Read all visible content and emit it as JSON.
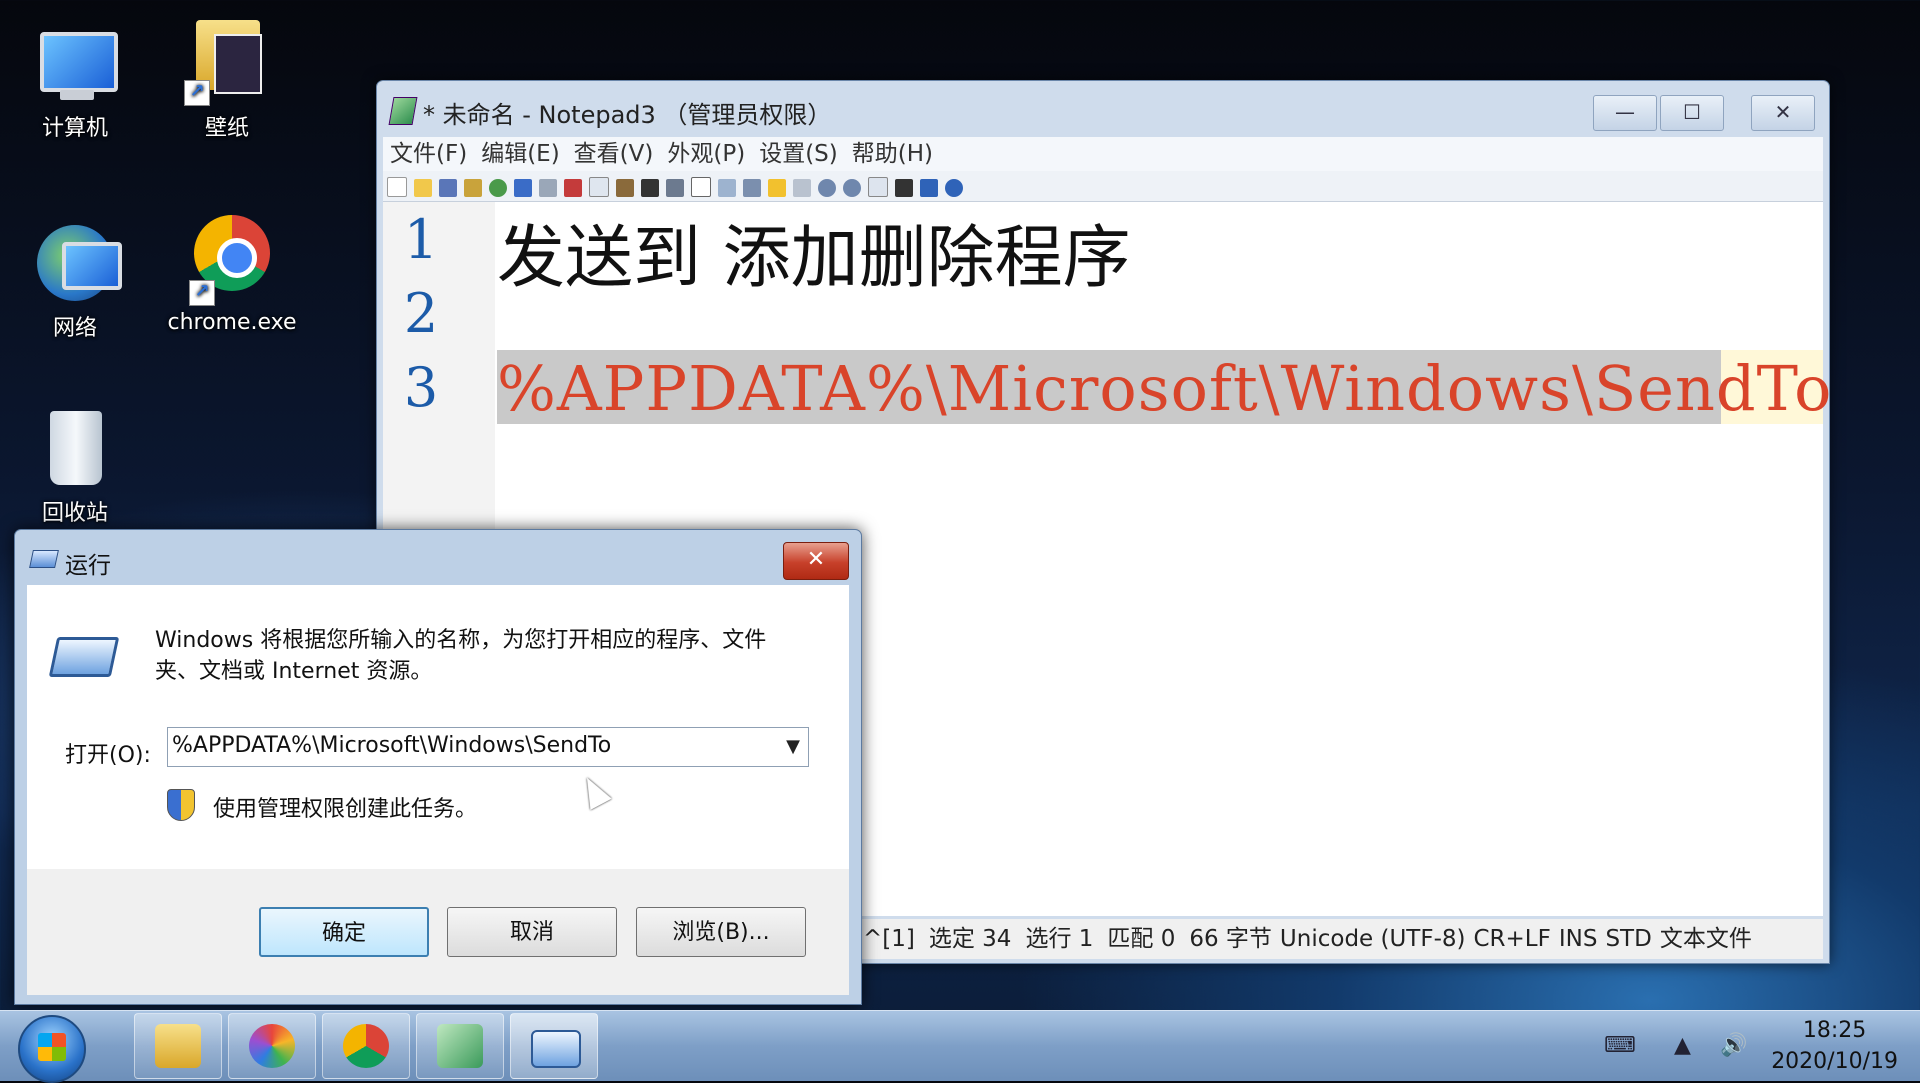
{
  "desktop": {
    "icons": [
      {
        "label": "计算机"
      },
      {
        "label": "壁纸"
      },
      {
        "label": "网络"
      },
      {
        "label": "chrome.exe"
      },
      {
        "label": "回收站"
      }
    ]
  },
  "notepad": {
    "title": "* 未命名 - Notepad3 （管理员权限）",
    "window_buttons": {
      "minimize": "—",
      "maximize": "☐",
      "close": "✕"
    },
    "menu": [
      "文件(F)",
      "编辑(E)",
      "查看(V)",
      "外观(P)",
      "设置(S)",
      "帮助(H)"
    ],
    "lines": [
      {
        "no": "1",
        "text": "发送到 添加删除程序"
      },
      {
        "no": "2",
        "text": ""
      },
      {
        "no": "3",
        "text": "%APPDATA%\\Microsoft\\Windows\\SendTo"
      }
    ],
    "status": [
      "^[1]",
      "选定  34",
      "选行  1",
      "匹配  0",
      "66 字节",
      "Unicode (UTF-8)",
      "CR+LF",
      "INS",
      "STD",
      "文本文件"
    ]
  },
  "run_dialog": {
    "title": "运行",
    "close": "✕",
    "description": "Windows 将根据您所输入的名称，为您打开相应的程序、文件夹、文档或 Internet 资源。",
    "open_label": "打开(O):",
    "open_value": "%APPDATA%\\Microsoft\\Windows\\SendTo",
    "dropdown_glyph": "▼",
    "admin_note": "使用管理权限创建此任务。",
    "buttons": {
      "ok": "确定",
      "cancel": "取消",
      "browse": "浏览(B)..."
    }
  },
  "taskbar": {
    "time": "18:25",
    "date": "2020/10/19"
  },
  "colors": {
    "line_number": "#1c5ba8",
    "highlight_text": "#d9442a",
    "current_line": "#fff8d8"
  }
}
